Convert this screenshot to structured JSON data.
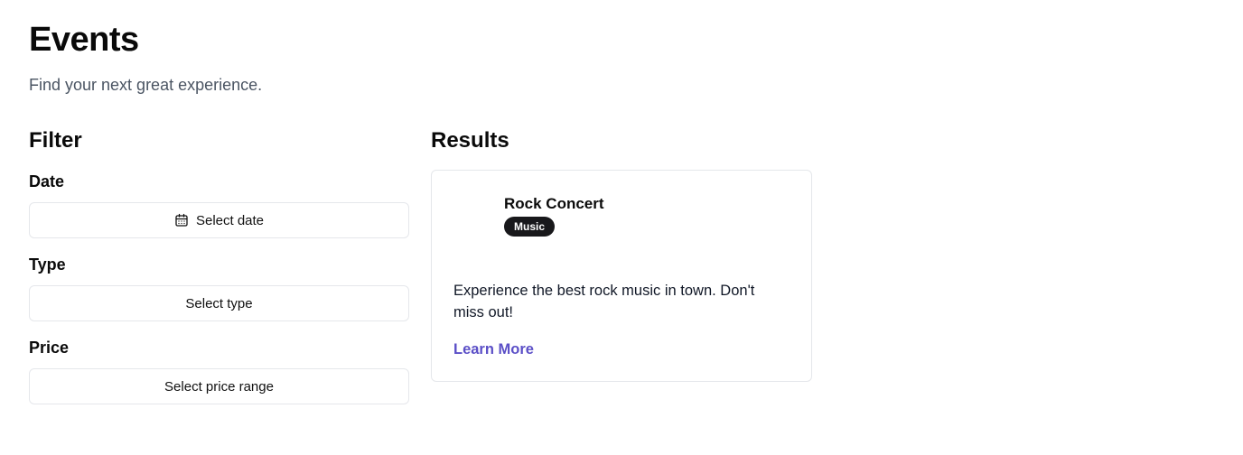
{
  "header": {
    "title": "Events",
    "subtitle": "Find your next great experience."
  },
  "filter": {
    "heading": "Filter",
    "date": {
      "label": "Date",
      "button": "Select date",
      "icon": "calendar-icon"
    },
    "type": {
      "label": "Type",
      "button": "Select type"
    },
    "price": {
      "label": "Price",
      "button": "Select price range"
    }
  },
  "results": {
    "heading": "Results",
    "items": [
      {
        "title": "Rock Concert",
        "badge": "Music",
        "description": "Experience the best rock music in town. Don't miss out!",
        "link": "Learn More"
      }
    ]
  },
  "colors": {
    "link": "#5b4fc7",
    "badge_bg": "#18181b",
    "border": "#e5e7eb",
    "subtitle": "#4b5563"
  }
}
